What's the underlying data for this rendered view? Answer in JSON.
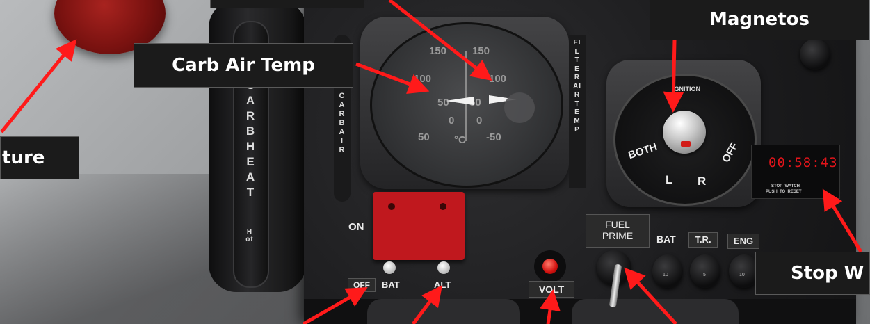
{
  "callouts": {
    "mixture": "ture",
    "carb_air_temp": "Carb Air Temp",
    "magnetos": "Magnetos",
    "stop_watch": "Stop W"
  },
  "carb_lever": {
    "text": "CARB HEAT",
    "hot": "Hot"
  },
  "gauge": {
    "left_label": "CARB AIR",
    "right_label": "FILTER AIR TEMP",
    "unit": "°C",
    "ticks_left": [
      "150",
      "100",
      "50",
      "0",
      "50"
    ],
    "ticks_right": [
      "150",
      "100",
      "50",
      "0",
      "-50"
    ]
  },
  "magnetos_switch": {
    "header": "IGNITION",
    "both": "BOTH",
    "left": "L",
    "right": "R",
    "off": "OFF"
  },
  "stopwatch": {
    "time": "00:58:43",
    "line1": "STOP  WATCH",
    "line2": "PUSH  TO  RESET"
  },
  "master_switch": {
    "on": "ON",
    "off": "OFF",
    "bat": "BAT",
    "alt": "ALT"
  },
  "volt": {
    "label": "VOLT"
  },
  "fuel_prime": {
    "line1": "FUEL",
    "line2": "PRIME"
  },
  "breakers": [
    {
      "label": "BAT",
      "rating": "10"
    },
    {
      "label": "T.R.",
      "rating": "5"
    },
    {
      "label": "ENG",
      "rating": "10"
    }
  ],
  "colors": {
    "arrow": "#ff1a1a",
    "callout_bg": "#1b1b1b",
    "guard_red": "#c0181e",
    "stopwatch_digits": "#e0141a"
  }
}
